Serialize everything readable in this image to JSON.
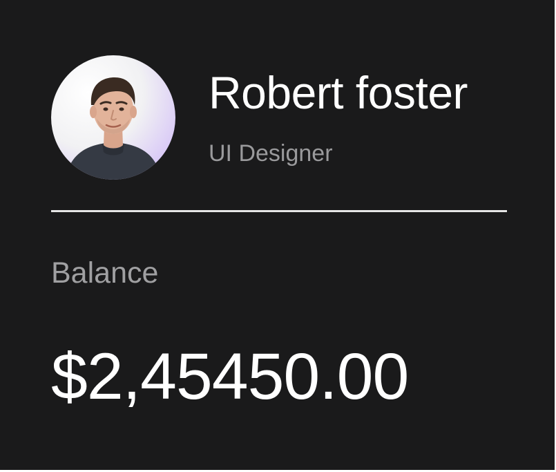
{
  "profile": {
    "name": "Robert foster",
    "role": "UI Designer",
    "avatar_icon": "user-portrait"
  },
  "balance": {
    "label": "Balance",
    "amount": "$2,45450.00"
  },
  "colors": {
    "background": "#1a1a1b",
    "primary_text": "#ffffff",
    "secondary_text": "#9a9a9c",
    "divider": "#e6e6e6",
    "avatar_accent": "#b79af0"
  }
}
